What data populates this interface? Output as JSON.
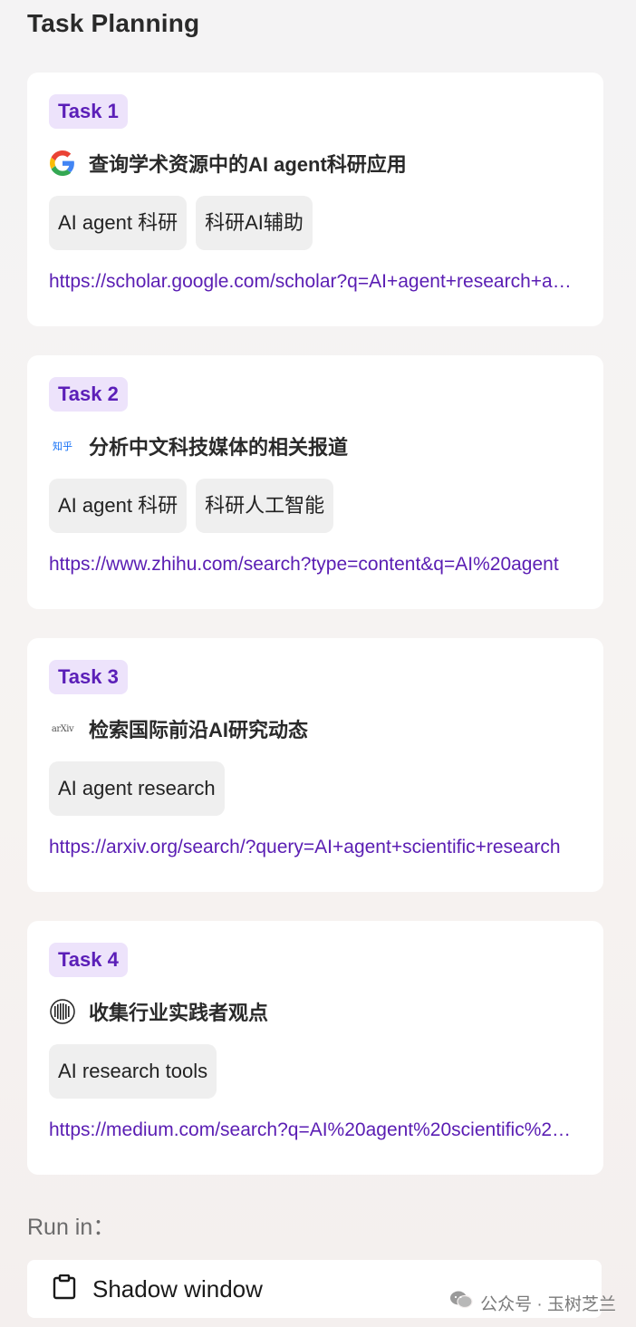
{
  "header": {
    "title": "Task Planning"
  },
  "tasks": [
    {
      "badge": "Task 1",
      "icon": "google-icon",
      "title": "查询学术资源中的AI agent科研应用",
      "tags": [
        "AI agent 科研",
        "科研AI辅助"
      ],
      "link": "https://scholar.google.com/scholar?q=AI+agent+research+application"
    },
    {
      "badge": "Task 2",
      "icon": "zhihu-icon",
      "icon_text": "知乎",
      "title": "分析中文科技媒体的相关报道",
      "tags": [
        "AI agent 科研",
        "科研人工智能"
      ],
      "link": "https://www.zhihu.com/search?type=content&q=AI%20agent"
    },
    {
      "badge": "Task 3",
      "icon": "arxiv-icon",
      "icon_text": "arXiv",
      "title": "检索国际前沿AI研究动态",
      "tags": [
        "AI agent research"
      ],
      "link": "https://arxiv.org/search/?query=AI+agent+scientific+research"
    },
    {
      "badge": "Task 4",
      "icon": "medium-icon",
      "title": "收集行业实践者观点",
      "tags": [
        "AI research tools"
      ],
      "link": "https://medium.com/search?q=AI%20agent%20scientific%20research"
    }
  ],
  "run": {
    "label": "Run in：",
    "option_label": "Shadow window",
    "option_icon": "clipboard-icon"
  },
  "watermark": {
    "text": "公众号 · 玉树芝兰",
    "icon": "wechat-icon"
  },
  "colors": {
    "accent": "#5a1db3",
    "badge_bg": "#ede3fb",
    "tag_bg": "#efefef",
    "card_bg": "#ffffff"
  }
}
